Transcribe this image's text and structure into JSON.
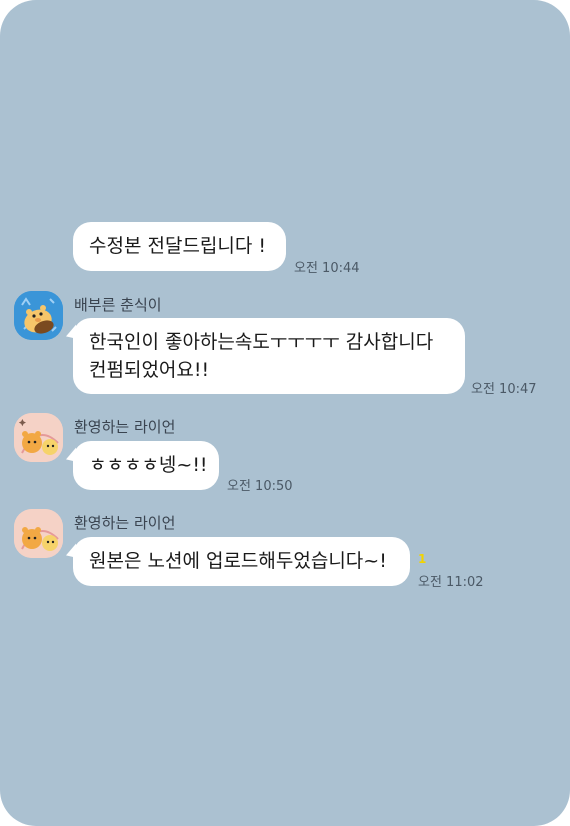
{
  "messages": [
    {
      "text": "수정본 전달드립니다 !",
      "time": "오전 10:44"
    },
    {
      "sender": "배부른 춘식이",
      "avatar": "chunsik-avatar",
      "line1": "한국인이 좋아하는속도ㅜㅜㅜㅜ 감사합니다",
      "line2": "컨펌되었어요!!",
      "time": "오전 10:47"
    },
    {
      "sender": "환영하는 라이언",
      "avatar": "ryan-avatar",
      "text": "ㅎㅎㅎㅎ넹~!!",
      "time": "오전 10:50"
    },
    {
      "sender": "환영하는 라이언",
      "avatar": "ryan-avatar",
      "text": "원본은 노션에 업로드해두었습니다~!",
      "unread": "1",
      "time": "오전 11:02"
    }
  ],
  "colors": {
    "background": "#abc1d1",
    "bubble": "#ffffff",
    "unread": "#f2d300"
  }
}
